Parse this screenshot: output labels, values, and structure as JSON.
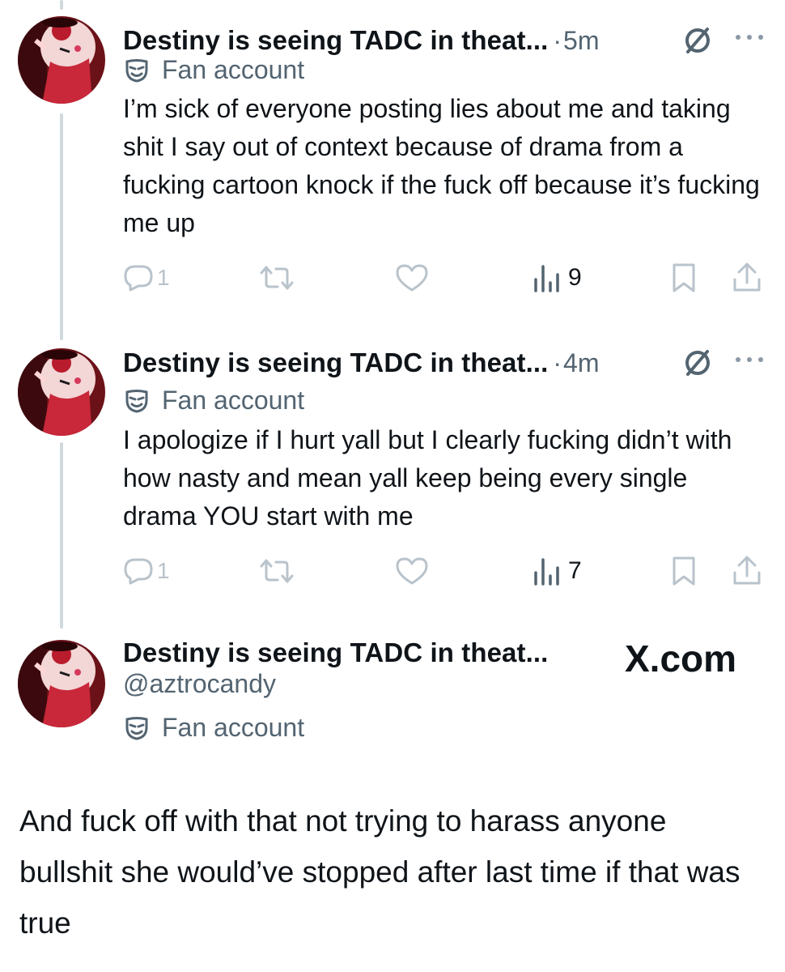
{
  "tweets": [
    {
      "name": "Destiny is seeing TADC in theat...",
      "time": "5m",
      "badge": "Fan account",
      "text": "I’m sick of everyone posting lies about me and taking shit I say out of context because of drama from a fucking cartoon knock if the fuck off because it’s fucking me up",
      "replies": "1",
      "views": "9"
    },
    {
      "name": "Destiny is seeing TADC in theat...",
      "time": "4m",
      "badge": "Fan account",
      "text": "I apologize if I hurt yall but I clearly fucking didn’t with how nasty and mean yall keep being every single drama YOU start with me",
      "replies": "1",
      "views": "7"
    }
  ],
  "profile": {
    "name": "Destiny is seeing TADC in theat...",
    "handle": "@aztrocandy",
    "badge": "Fan account"
  },
  "watermark": "X.com",
  "caption": "And fuck off with that not trying to harass anyone bullshit she would’ve stopped after last time if that was true",
  "colors": {
    "text": "#0f1419",
    "secondary": "#536471",
    "icon": "#b9c3cb",
    "thread_line": "#cfd9de"
  },
  "icons": [
    "reply-icon",
    "retweet-icon",
    "like-icon",
    "views-icon",
    "bookmark-icon",
    "share-icon",
    "grok-slash-icon",
    "more-icon",
    "fan-account-mask-icon"
  ]
}
